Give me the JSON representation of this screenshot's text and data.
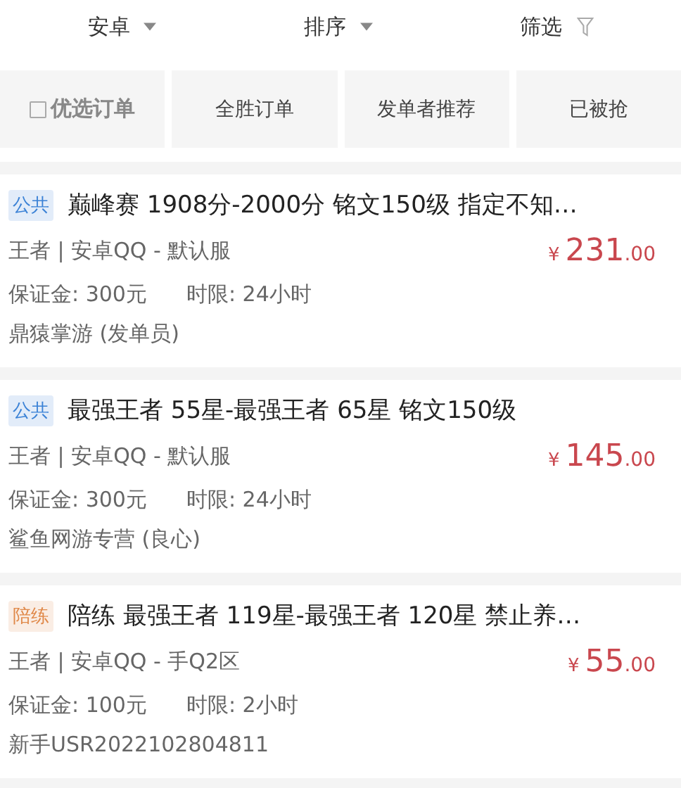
{
  "top_bar": [
    {
      "kind": "dropdown",
      "label": "安卓"
    },
    {
      "kind": "dropdown",
      "label": "排序"
    },
    {
      "kind": "filter",
      "label": "筛选"
    }
  ],
  "filter_chips": [
    {
      "kind": "checkbox",
      "label": "优选订单",
      "checked": false
    },
    {
      "kind": "plain",
      "label": "全胜订单"
    },
    {
      "kind": "plain",
      "label": "发单者推荐"
    },
    {
      "kind": "plain",
      "label": "已被抢"
    }
  ],
  "orders": [
    {
      "tag": {
        "label": "公共",
        "color": "#3b82d6"
      },
      "title": "巅峰赛 1908分-2000分 铭文150级 指定不知…",
      "game": "王者 | 安卓QQ - 默认服",
      "deposit": "保证金: 300元",
      "time_limit": "时限: 24小时",
      "publisher": "鼎猿掌游 (发单员)",
      "price_symbol": "¥",
      "price_integer": "231",
      "price_decimal": ".00"
    },
    {
      "tag": {
        "label": "公共",
        "color": "#3b82d6"
      },
      "title": "最强王者 55星-最强王者 65星 铭文150级",
      "game": "王者 | 安卓QQ - 默认服",
      "deposit": "保证金: 300元",
      "time_limit": "时限: 24小时",
      "publisher": "鲨鱼网游专营 (良心)",
      "price_symbol": "¥",
      "price_integer": "145",
      "price_decimal": ".00"
    },
    {
      "tag": {
        "label": "陪练",
        "color": "#e0894a"
      },
      "title": "陪练 最强王者 119星-最强王者 120星 禁止养…",
      "game": "王者 | 安卓QQ - 手Q2区",
      "deposit": "保证金: 100元",
      "time_limit": "时限: 2小时",
      "publisher": "新手USR2022102804811",
      "price_symbol": "¥",
      "price_integer": "55",
      "price_decimal": ".00"
    }
  ]
}
